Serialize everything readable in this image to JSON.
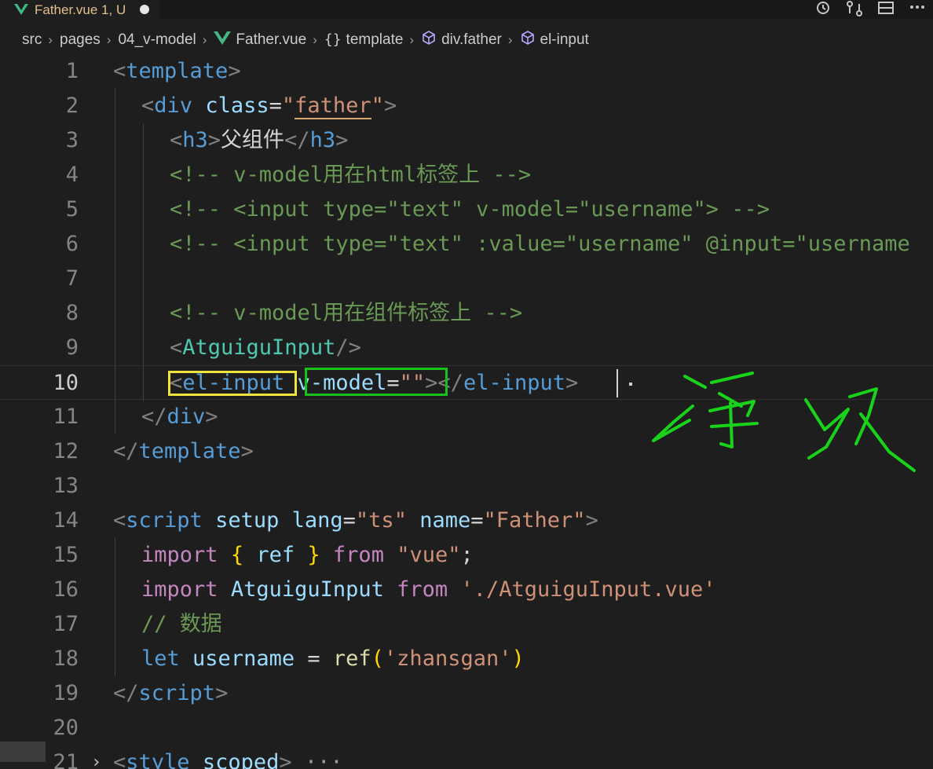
{
  "tab": {
    "filename": "Father.vue 1, U"
  },
  "breadcrumb": [
    {
      "label": "src",
      "icon": ""
    },
    {
      "label": "pages",
      "icon": ""
    },
    {
      "label": "04_v-model",
      "icon": ""
    },
    {
      "label": "Father.vue",
      "icon": "vue-icon"
    },
    {
      "label": "template",
      "icon": "braces-icon"
    },
    {
      "label": "div.father",
      "icon": "cube-icon"
    },
    {
      "label": "el-input",
      "icon": "cube-icon"
    }
  ],
  "lines": [
    {
      "n": "1",
      "indent": 0,
      "tokens": [
        [
          "br",
          "<"
        ],
        [
          "tag",
          "template"
        ],
        [
          "br",
          ">"
        ]
      ]
    },
    {
      "n": "2",
      "indent": 1,
      "tokens": [
        [
          "br",
          "<"
        ],
        [
          "tag",
          "div"
        ],
        [
          "txt",
          " "
        ],
        [
          "attr",
          "class"
        ],
        [
          "txt",
          "="
        ],
        [
          "str",
          "\""
        ],
        [
          "strU",
          "father"
        ],
        [
          "str",
          "\""
        ],
        [
          "br",
          ">"
        ]
      ]
    },
    {
      "n": "3",
      "indent": 2,
      "tokens": [
        [
          "br",
          "<"
        ],
        [
          "tag",
          "h3"
        ],
        [
          "br",
          ">"
        ],
        [
          "txt",
          "父组件"
        ],
        [
          "br",
          "</"
        ],
        [
          "tag",
          "h3"
        ],
        [
          "br",
          ">"
        ]
      ]
    },
    {
      "n": "4",
      "indent": 2,
      "tokens": [
        [
          "com",
          "<!-- v-model用在html标签上 -->"
        ]
      ]
    },
    {
      "n": "5",
      "indent": 2,
      "tokens": [
        [
          "com",
          "<!-- <input type=\"text\" v-model=\"username\"> -->"
        ]
      ]
    },
    {
      "n": "6",
      "indent": 2,
      "tokens": [
        [
          "com",
          "<!-- <input type=\"text\" :value=\"username\" @input=\"username"
        ]
      ]
    },
    {
      "n": "7",
      "indent": 2,
      "tokens": []
    },
    {
      "n": "8",
      "indent": 2,
      "tokens": [
        [
          "com",
          "<!-- v-model用在组件标签上 -->"
        ]
      ]
    },
    {
      "n": "9",
      "indent": 2,
      "tokens": [
        [
          "br",
          "<"
        ],
        [
          "comp",
          "AtguiguInput"
        ],
        [
          "br",
          "/>"
        ]
      ]
    },
    {
      "n": "10",
      "indent": 2,
      "tokens": [
        [
          "br",
          "<"
        ],
        [
          "tag",
          "el-input"
        ],
        [
          "txt",
          " "
        ],
        [
          "attr",
          "v-model"
        ],
        [
          "txt",
          "="
        ],
        [
          "str",
          "\"\""
        ],
        [
          "br",
          ">"
        ],
        [
          "br",
          "</"
        ],
        [
          "tag",
          "el-input"
        ],
        [
          "br",
          ">"
        ]
      ]
    },
    {
      "n": "11",
      "indent": 1,
      "tokens": [
        [
          "br",
          "</"
        ],
        [
          "tag",
          "div"
        ],
        [
          "br",
          ">"
        ]
      ]
    },
    {
      "n": "12",
      "indent": 0,
      "tokens": [
        [
          "br",
          "</"
        ],
        [
          "tag",
          "template"
        ],
        [
          "br",
          ">"
        ]
      ]
    },
    {
      "n": "13",
      "indent": 0,
      "tokens": []
    },
    {
      "n": "14",
      "indent": 0,
      "tokens": [
        [
          "br",
          "<"
        ],
        [
          "tag",
          "script"
        ],
        [
          "txt",
          " "
        ],
        [
          "attr",
          "setup"
        ],
        [
          "txt",
          " "
        ],
        [
          "attr",
          "lang"
        ],
        [
          "txt",
          "="
        ],
        [
          "str",
          "\"ts\""
        ],
        [
          "txt",
          " "
        ],
        [
          "attr",
          "name"
        ],
        [
          "txt",
          "="
        ],
        [
          "str",
          "\"Father\""
        ],
        [
          "br",
          ">"
        ]
      ]
    },
    {
      "n": "15",
      "indent": 1,
      "tokens": [
        [
          "kw",
          "import"
        ],
        [
          "txt",
          " "
        ],
        [
          "yel",
          "{"
        ],
        [
          "txt",
          " "
        ],
        [
          "var",
          "ref"
        ],
        [
          "txt",
          " "
        ],
        [
          "yel",
          "}"
        ],
        [
          "txt",
          " "
        ],
        [
          "kw",
          "from"
        ],
        [
          "txt",
          " "
        ],
        [
          "str",
          "\"vue\""
        ],
        [
          "txt",
          ";"
        ]
      ]
    },
    {
      "n": "16",
      "indent": 1,
      "tokens": [
        [
          "kw",
          "import"
        ],
        [
          "txt",
          " "
        ],
        [
          "var",
          "AtguiguInput"
        ],
        [
          "txt",
          " "
        ],
        [
          "kw",
          "from"
        ],
        [
          "txt",
          " "
        ],
        [
          "str",
          "'./AtguiguInput.vue'"
        ]
      ]
    },
    {
      "n": "17",
      "indent": 1,
      "tokens": [
        [
          "com",
          "// 数据"
        ]
      ]
    },
    {
      "n": "18",
      "indent": 1,
      "tokens": [
        [
          "blu",
          "let"
        ],
        [
          "txt",
          " "
        ],
        [
          "var",
          "username"
        ],
        [
          "txt",
          " = "
        ],
        [
          "fn",
          "ref"
        ],
        [
          "yel",
          "("
        ],
        [
          "str",
          "'zhansgan'"
        ],
        [
          "yel",
          ")"
        ]
      ]
    },
    {
      "n": "19",
      "indent": 0,
      "tokens": [
        [
          "br",
          "</"
        ],
        [
          "tag",
          "script"
        ],
        [
          "br",
          ">"
        ]
      ]
    },
    {
      "n": "20",
      "indent": 0,
      "tokens": []
    },
    {
      "n": "21",
      "indent": 0,
      "tokens": [
        [
          "br",
          "<"
        ],
        [
          "tag",
          "style"
        ],
        [
          "txt",
          " "
        ],
        [
          "attr",
          "scoped"
        ],
        [
          "br",
          ">"
        ],
        [
          "fold",
          " ···"
        ]
      ]
    }
  ],
  "current_line": "10",
  "colors": {
    "editor_bg": "#1e1e1e",
    "annotation_yellow": "#f0e43c",
    "annotation_green": "#18c21c"
  }
}
